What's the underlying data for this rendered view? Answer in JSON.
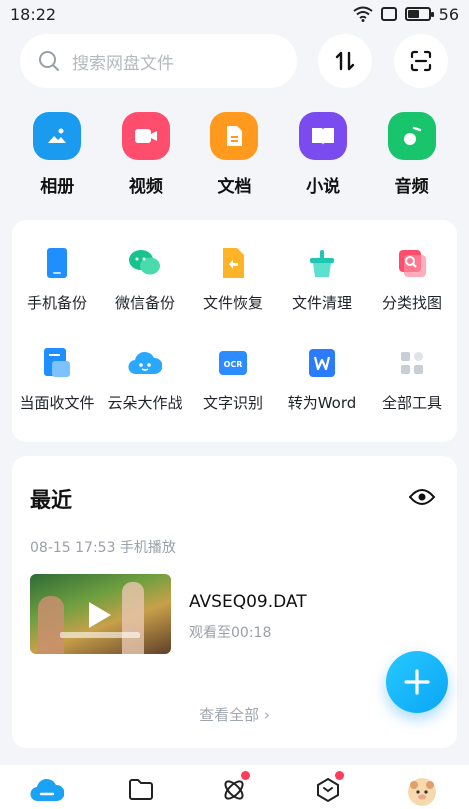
{
  "status_bar": {
    "time": "18:22",
    "battery": "56",
    "battery_level": 0.56
  },
  "search": {
    "placeholder": "搜索网盘文件"
  },
  "header_buttons": {
    "sort_icon": "sort-arrows-icon",
    "scan_icon": "scan-icon"
  },
  "categories": [
    {
      "label": "相册",
      "icon": "photo-album-icon",
      "color": "#1a9bf0"
    },
    {
      "label": "视频",
      "icon": "video-icon",
      "color": "#ff4d6d"
    },
    {
      "label": "文档",
      "icon": "document-icon",
      "color": "#ff9a1f"
    },
    {
      "label": "小说",
      "icon": "book-icon",
      "color": "#7a4cf0"
    },
    {
      "label": "音频",
      "icon": "music-icon",
      "color": "#18c46c"
    }
  ],
  "tools": [
    {
      "label": "手机备份",
      "icon": "phone-backup-icon"
    },
    {
      "label": "微信备份",
      "icon": "wechat-backup-icon"
    },
    {
      "label": "文件恢复",
      "icon": "file-restore-icon"
    },
    {
      "label": "文件清理",
      "icon": "file-clean-icon"
    },
    {
      "label": "分类找图",
      "icon": "image-search-icon"
    },
    {
      "label": "当面收文件",
      "icon": "receive-file-icon"
    },
    {
      "label": "云朵大作战",
      "icon": "cloud-game-icon"
    },
    {
      "label": "文字识别",
      "icon": "ocr-icon"
    },
    {
      "label": "转为Word",
      "icon": "word-convert-icon"
    },
    {
      "label": "全部工具",
      "icon": "all-tools-icon"
    }
  ],
  "recent": {
    "title": "最近",
    "meta": "08-15 17:53  手机播放",
    "file_name": "AVSEQ09.DAT",
    "progress": "观看至00:18",
    "view_all": "查看全部 ›"
  },
  "ocr_badge": "OCR",
  "bottom_nav": [
    {
      "name": "nav-home",
      "icon": "cloud-home-icon",
      "badge": false
    },
    {
      "name": "nav-files",
      "icon": "folder-icon",
      "badge": false
    },
    {
      "name": "nav-discover",
      "icon": "orbit-icon",
      "badge": true
    },
    {
      "name": "nav-apps",
      "icon": "hexagon-icon",
      "badge": true
    },
    {
      "name": "nav-profile",
      "icon": "avatar-icon",
      "badge": false
    }
  ]
}
